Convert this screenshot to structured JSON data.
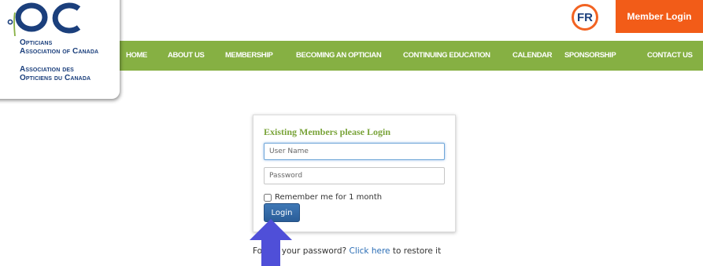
{
  "logo": {
    "line1": "Opticians",
    "line2": "Association of Canada",
    "line3": "Association des",
    "line4": "Opticiens du Canada"
  },
  "nav": {
    "items": [
      "HOME",
      "ABOUT US",
      "MEMBERSHIP",
      "BECOMING AN OPTICIAN",
      "CONTINUING EDUCATION",
      "CALENDAR",
      "SPONSORSHIP",
      "CONTACT US"
    ]
  },
  "header": {
    "language_label": "FR",
    "member_login_label": "Member Login"
  },
  "login": {
    "title": "Existing Members please Login",
    "username_placeholder": "User Name",
    "password_placeholder": "Password",
    "remember_label": "Remember me for 1 month",
    "button_label": "Login"
  },
  "forgot": {
    "prefix": "Forgot your password?",
    "link": "Click here",
    "suffix": "to restore it"
  },
  "colors": {
    "nav_green": "#86b043",
    "brand_blue": "#1b3f7c",
    "accent_orange": "#f25c18",
    "annotation_arrow": "#4f4fd8"
  }
}
